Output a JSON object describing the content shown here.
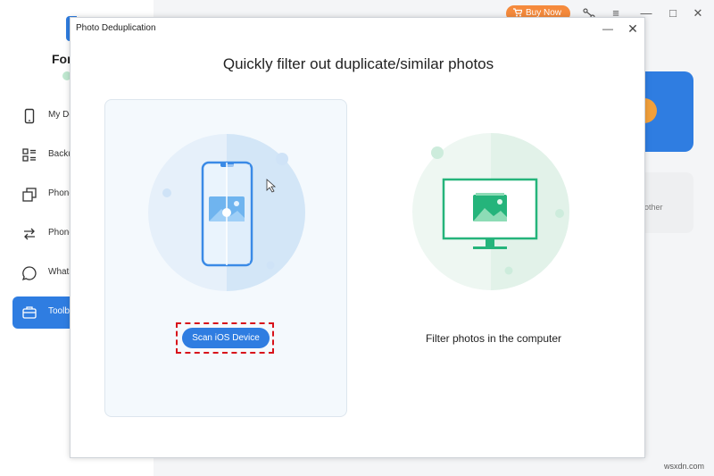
{
  "app": {
    "brand": "For",
    "buy_now": "Buy Now",
    "sidebar": [
      {
        "label": "My De",
        "icon": "phone-icon"
      },
      {
        "label": "Backu",
        "icon": "backup-list-icon"
      },
      {
        "label": "Phone",
        "icon": "copy-icon"
      },
      {
        "label": "Phone",
        "icon": "transfer-icon"
      },
      {
        "label": "Whats",
        "icon": "chat-bubble-icon"
      },
      {
        "label": "Toolb",
        "icon": "toolbox-icon",
        "active": true
      }
    ],
    "right_card_text": "other"
  },
  "dialog": {
    "title": "Photo Deduplication",
    "heading": "Quickly filter out duplicate/similar photos",
    "ios_option": {
      "button": "Scan iOS Device"
    },
    "pc_option": {
      "label": "Filter photos in the computer"
    }
  },
  "watermark": "wsxdn.com",
  "colors": {
    "accent": "#2f7de1",
    "green": "#25b47b",
    "highlight": "#d8131b",
    "buy": "#f58a3c"
  }
}
